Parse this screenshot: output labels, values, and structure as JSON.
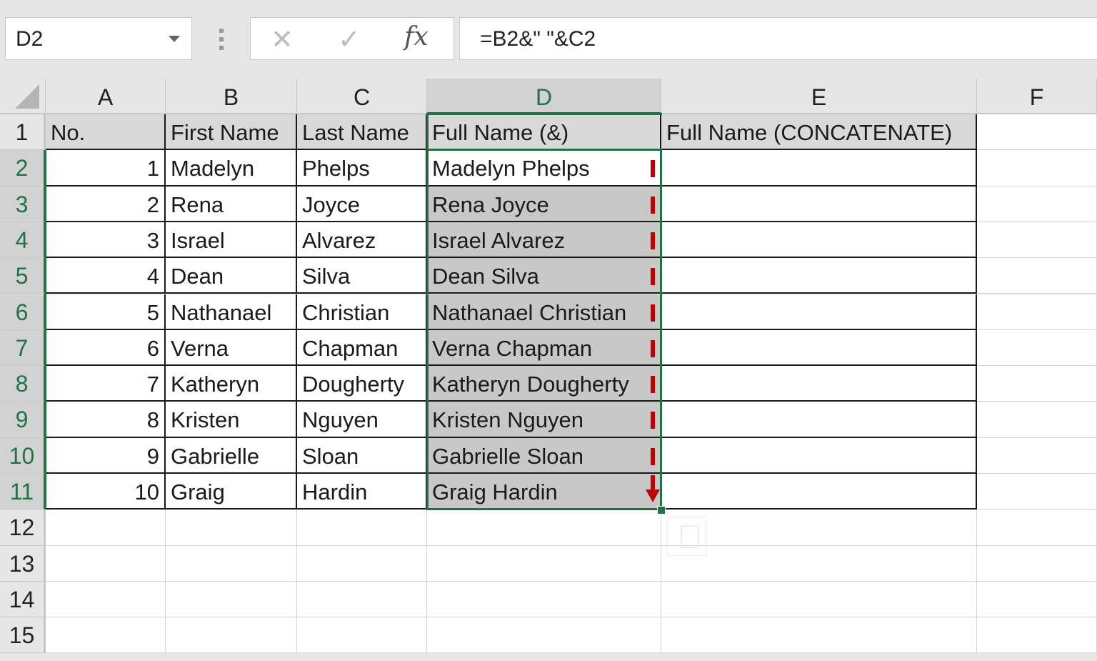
{
  "formula_bar": {
    "name_box": "D2",
    "cancel_icon": "✕",
    "enter_icon": "✓",
    "fx_label": "fx",
    "formula": "=B2&\" \"&C2"
  },
  "columns": [
    "A",
    "B",
    "C",
    "D",
    "E",
    "F"
  ],
  "rows": [
    "1",
    "2",
    "3",
    "4",
    "5",
    "6",
    "7",
    "8",
    "9",
    "10",
    "11",
    "12",
    "13",
    "14",
    "15"
  ],
  "selected_column": "D",
  "selected_range": "D2:D11",
  "active_cell": "D2",
  "headers": [
    "No.",
    "First Name",
    "Last Name",
    "Full Name (&)",
    "Full Name (CONCATENATE)"
  ],
  "table": [
    {
      "no": "1",
      "first": "Madelyn",
      "last": "Phelps",
      "full": "Madelyn Phelps",
      "concat": ""
    },
    {
      "no": "2",
      "first": "Rena",
      "last": "Joyce",
      "full": "Rena Joyce",
      "concat": ""
    },
    {
      "no": "3",
      "first": "Israel",
      "last": "Alvarez",
      "full": "Israel Alvarez",
      "concat": ""
    },
    {
      "no": "4",
      "first": "Dean",
      "last": "Silva",
      "full": "Dean Silva",
      "concat": ""
    },
    {
      "no": "5",
      "first": "Nathanael",
      "last": "Christian",
      "full": "Nathanael Christian",
      "concat": ""
    },
    {
      "no": "6",
      "first": "Verna",
      "last": "Chapman",
      "full": "Verna Chapman",
      "concat": ""
    },
    {
      "no": "7",
      "first": "Katheryn",
      "last": "Dougherty",
      "full": "Katheryn Dougherty",
      "concat": ""
    },
    {
      "no": "8",
      "first": "Kristen",
      "last": "Nguyen",
      "full": "Kristen Nguyen",
      "concat": ""
    },
    {
      "no": "9",
      "first": "Gabrielle",
      "last": "Sloan",
      "full": "Gabrielle Sloan",
      "concat": ""
    },
    {
      "no": "10",
      "first": "Graig",
      "last": "Hardin",
      "full": "Graig Hardin",
      "concat": ""
    }
  ],
  "colors": {
    "selection_green": "#217346",
    "annotation_red": "#c00000",
    "header_fill": "#d9d9d9"
  }
}
